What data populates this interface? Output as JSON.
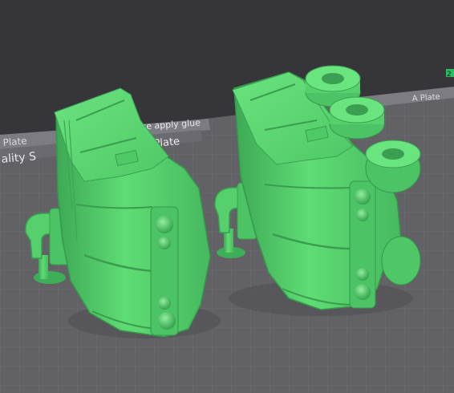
{
  "plate": {
    "tab_left": "Plate",
    "tab_right": "A Plate",
    "quality_label": "ality S",
    "plate_label": "Plate",
    "glue_note": "ase apply glue"
  },
  "corner_marker": "2",
  "colors": {
    "background": "#36363a",
    "plate": "#626266",
    "grid_line": "#6f6f74",
    "model_green": "#58d66f",
    "model_shadow": "#2f8f44"
  }
}
